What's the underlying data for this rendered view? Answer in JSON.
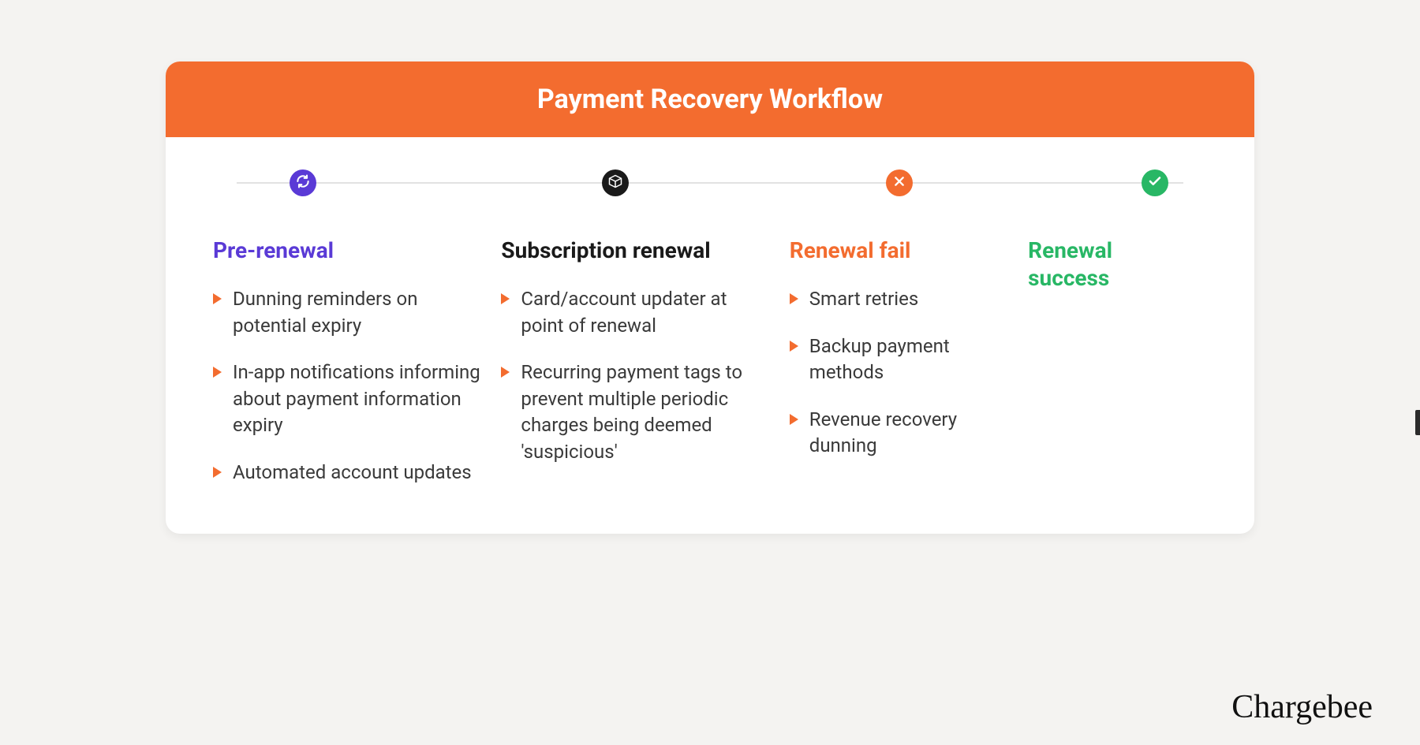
{
  "title": "Payment Recovery Workflow",
  "brand": "Chargebee",
  "columns": [
    {
      "title": "Pre-renewal",
      "color": "#5a3ad6",
      "icon": "refresh",
      "iconBg": "#5a3ad6",
      "width": "29%",
      "nodeLeft": "7%",
      "bullets": [
        "Dunning reminders on potential expiry",
        "In-app notifications informing about payment information expiry",
        "Automated account updates"
      ]
    },
    {
      "title": "Subscription renewal",
      "color": "#1a1a1a",
      "icon": "box",
      "iconBg": "#1a1a1a",
      "width": "29%",
      "nodeLeft": "40%",
      "bullets": [
        "Card/account updater at point of renewal",
        "Recurring payment tags to prevent multiple periodic charges being deemed 'suspicious'"
      ]
    },
    {
      "title": "Renewal fail",
      "color": "#f36c2f",
      "icon": "x",
      "iconBg": "#f36c2f",
      "width": "24%",
      "nodeLeft": "70%",
      "bullets": [
        "Smart retries",
        "Backup payment methods",
        "Revenue recovery dunning"
      ]
    },
    {
      "title": "Renewal success",
      "color": "#28b765",
      "icon": "check",
      "iconBg": "#28b765",
      "width": "18%",
      "nodeLeft": "97%",
      "bullets": []
    }
  ]
}
